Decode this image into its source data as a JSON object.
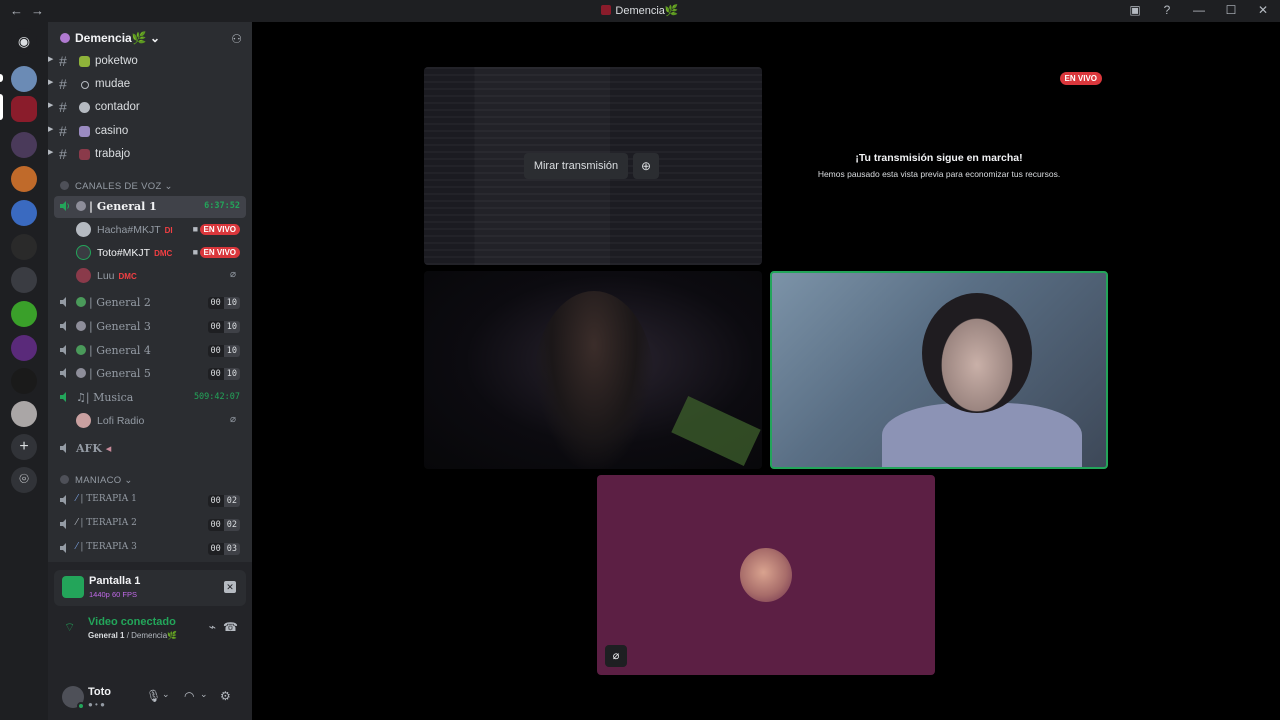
{
  "titlebar": {
    "title": "Demencia🌿"
  },
  "guild": {
    "name": "Demencia🌿"
  },
  "text_channels": [
    {
      "name": "poketwo",
      "color": "#8fb33a"
    },
    {
      "name": "mudae",
      "color": "#2b2d31"
    },
    {
      "name": "contador",
      "color": "#b5bac1"
    },
    {
      "name": "casino",
      "color": "#9a8bc1"
    },
    {
      "name": "trabajo",
      "color": "#8a3a4a"
    }
  ],
  "categories": {
    "voice": "CANALES DE VOZ",
    "maniaco": "MANIACO"
  },
  "voice_channels": {
    "general1": {
      "name": "General 1",
      "timer": "6:37:52"
    },
    "general2": {
      "name": "General 2",
      "count": "00",
      "limit": "10"
    },
    "general3": {
      "name": "General 3",
      "count": "00",
      "limit": "10"
    },
    "general4": {
      "name": "General 4",
      "count": "00",
      "limit": "10"
    },
    "general5": {
      "name": "General 5",
      "count": "00",
      "limit": "10"
    },
    "musica": {
      "name": "Musica",
      "timer": "509:42:07"
    },
    "afk": {
      "name": "AFK"
    },
    "terapia1": {
      "name": "TERAPIA 1",
      "count": "00",
      "limit": "02"
    },
    "terapia2": {
      "name": "TERAPIA 2",
      "count": "00",
      "limit": "02"
    },
    "terapia3": {
      "name": "TERAPIA 3",
      "count": "00",
      "limit": "03"
    }
  },
  "voice_users": {
    "hacha": {
      "name": "Hacha#MKJT",
      "tag": "DI",
      "live": "EN VIVO"
    },
    "toto": {
      "name": "Toto#MKJT",
      "tag": "DMC",
      "live": "EN VIVO"
    },
    "luu": {
      "name": "Luu",
      "tag": "DMC"
    },
    "lofi": {
      "name": "Lofi Radio"
    }
  },
  "share_panel": {
    "title": "Pantalla 1",
    "quality": "1440p 60 FPS"
  },
  "connection": {
    "status": "Video conectado",
    "channel": "General 1",
    "guild": "Demencia🌿"
  },
  "me": {
    "name": "Toto"
  },
  "stage": {
    "watch_label": "Mirar transmisión",
    "live_badge": "EN VIVO",
    "paused_title": "¡Tu transmisión sigue en marcha!",
    "paused_subtitle": "Hemos pausado esta vista previa para economizar tus recursos."
  },
  "colors": {
    "accent_green": "#23a55a",
    "live_red": "#da373c",
    "sidebar": "#2b2d31",
    "rail": "#1e1f22"
  }
}
